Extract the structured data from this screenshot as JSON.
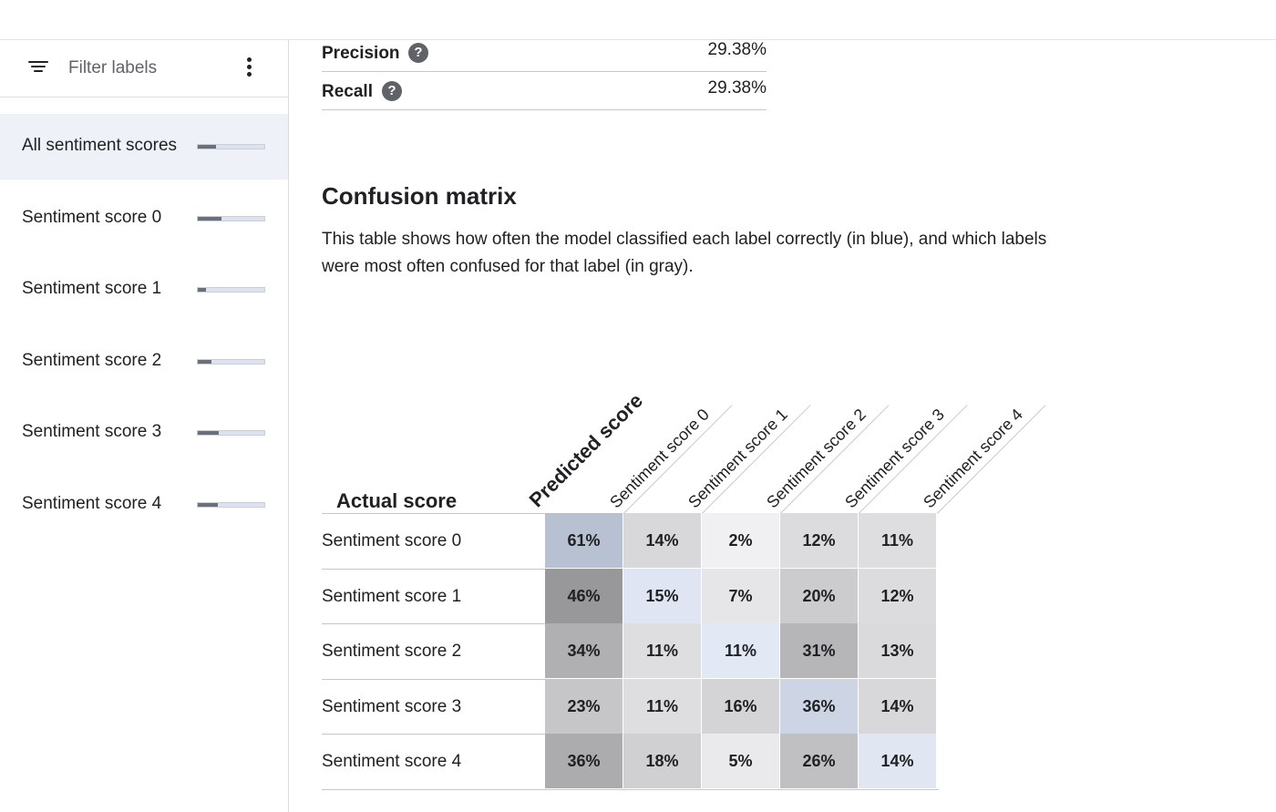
{
  "sidebar": {
    "filter_label": "Filter labels",
    "items": [
      {
        "label": "All sentiment scores",
        "fill": 0.28,
        "selected": true
      },
      {
        "label": "Sentiment score 0",
        "fill": 0.36,
        "selected": false
      },
      {
        "label": "Sentiment score 1",
        "fill": 0.13,
        "selected": false
      },
      {
        "label": "Sentiment score 2",
        "fill": 0.2,
        "selected": false
      },
      {
        "label": "Sentiment score 3",
        "fill": 0.31,
        "selected": false
      },
      {
        "label": "Sentiment score 4",
        "fill": 0.3,
        "selected": false
      }
    ]
  },
  "metrics": {
    "precision": {
      "label": "Precision",
      "value": "29.38%"
    },
    "recall": {
      "label": "Recall",
      "value": "29.38%"
    },
    "help_glyph": "?"
  },
  "confusion": {
    "title": "Confusion matrix",
    "description": "This table shows how often the model classified each label correctly (in blue), and which labels were most often confused for that label (in gray).",
    "actual_header": "Actual score",
    "predicted_header": "Predicted score",
    "columns": [
      "Sentiment score 0",
      "Sentiment score 1",
      "Sentiment score 2",
      "Sentiment score 3",
      "Sentiment score 4"
    ],
    "rows": [
      {
        "label": "Sentiment score 0",
        "cells": [
          "61%",
          "14%",
          "2%",
          "12%",
          "11%"
        ]
      },
      {
        "label": "Sentiment score 1",
        "cells": [
          "46%",
          "15%",
          "7%",
          "20%",
          "12%"
        ]
      },
      {
        "label": "Sentiment score 2",
        "cells": [
          "34%",
          "11%",
          "11%",
          "31%",
          "13%"
        ]
      },
      {
        "label": "Sentiment score 3",
        "cells": [
          "23%",
          "11%",
          "16%",
          "36%",
          "14%"
        ]
      },
      {
        "label": "Sentiment score 4",
        "cells": [
          "36%",
          "18%",
          "5%",
          "26%",
          "14%"
        ]
      }
    ],
    "colors": {
      "correct": "#b8c1d2",
      "confused": "#9a9a9a",
      "blue_tint": "#e9eef9"
    }
  }
}
